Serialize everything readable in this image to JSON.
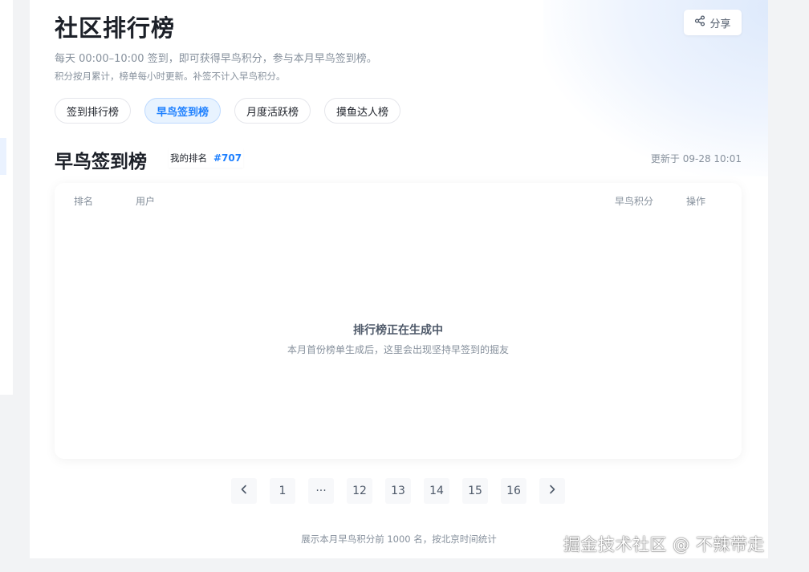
{
  "header": {
    "title": "社区排行榜",
    "description": "每天 00:00–10:00 签到，即可获得早鸟积分，参与本月早鸟签到榜。",
    "subdescription": "积分按月累计，榜单每小时更新。补签不计入早鸟积分。",
    "share_label": "分享"
  },
  "tabs": [
    {
      "label": "签到排行榜",
      "active": false
    },
    {
      "label": "早鸟签到榜",
      "active": true
    },
    {
      "label": "月度活跃榜",
      "active": false
    },
    {
      "label": "摸鱼达人榜",
      "active": false
    }
  ],
  "section": {
    "title": "早鸟签到榜",
    "my_rank_label": "我的排名",
    "my_rank_value": "#707",
    "updated": "更新于 09-28 10:01"
  },
  "table": {
    "columns": [
      "排名",
      "用户",
      "早鸟积分",
      "操作"
    ],
    "empty_title": "排行榜正在生成中",
    "empty_desc": "本月首份榜单生成后，这里会出现坚持早签到的掘友"
  },
  "pagination": {
    "prev_icon": "chevron-left-icon",
    "next_icon": "chevron-right-icon",
    "pages": [
      "1",
      "···",
      "12",
      "13",
      "14",
      "15",
      "16"
    ]
  },
  "footnote": "展示本月早鸟积分前 1000 名，按北京时间统计",
  "watermark": "掘金技术社区 @ 不辣带走",
  "colors": {
    "accent": "#1e80ff",
    "active_tab_bg": "#e8f3ff",
    "text_primary": "#1d2129",
    "text_secondary": "#86909c",
    "page_bg": "#f2f3f5"
  }
}
